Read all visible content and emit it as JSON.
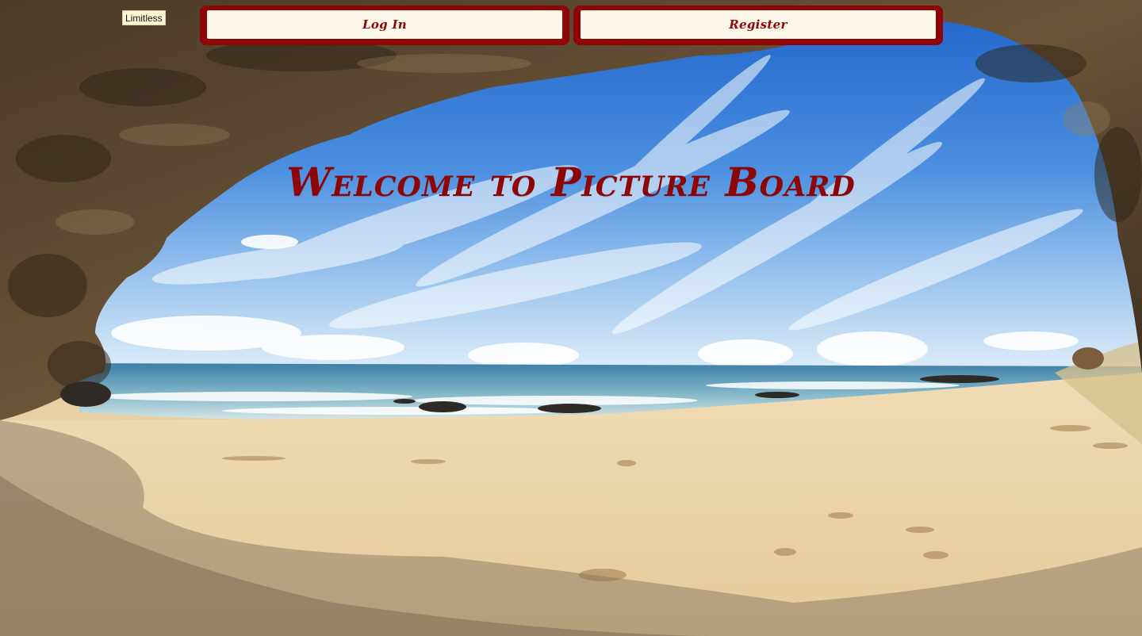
{
  "brand": {
    "label": "Limitless"
  },
  "nav": {
    "login_label": "Log In",
    "register_label": "Register"
  },
  "hero": {
    "title": "Welcome to Picture Board"
  },
  "colors": {
    "accent": "#8d0505",
    "button_face": "#fdf6ea",
    "brand_bg": "#fdf6d2"
  },
  "background": {
    "description_icon": "beach-cave-photo"
  }
}
